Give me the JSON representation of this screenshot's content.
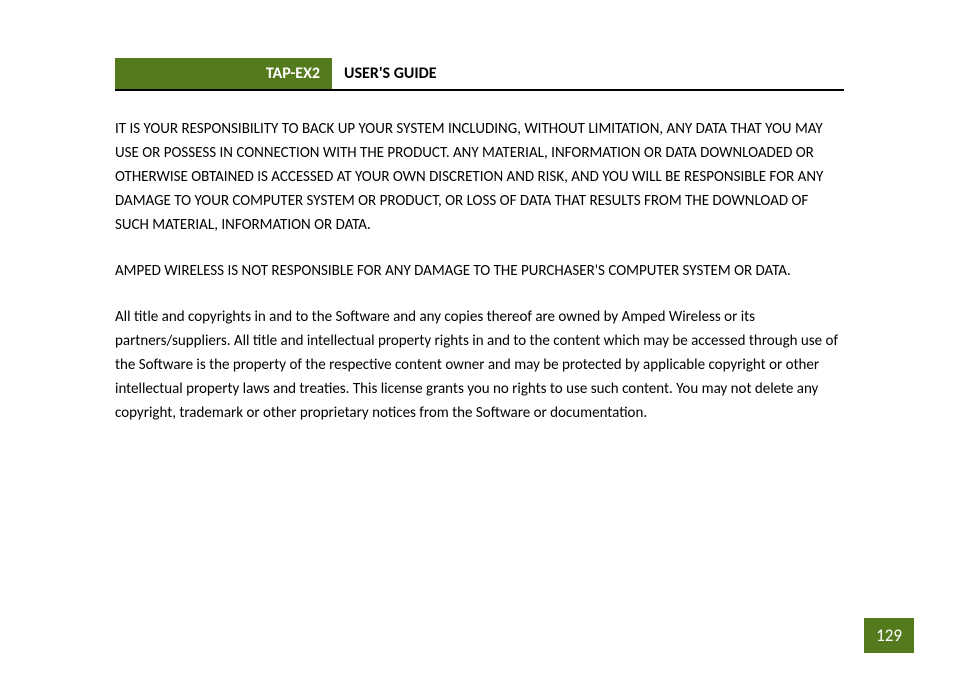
{
  "header": {
    "product": "TAP-EX2",
    "title": "USER'S GUIDE"
  },
  "paragraphs": [
    "IT IS YOUR RESPONSIBILITY TO BACK UP YOUR SYSTEM INCLUDING, WITHOUT LIMITATION, ANY DATA THAT YOU MAY USE OR POSSESS IN CONNECTION WITH THE PRODUCT.  ANY MATERIAL, INFORMATION OR DATA DOWNLOADED OR OTHERWISE OBTAINED IS ACCESSED AT YOUR OWN DISCRETION AND RISK, AND YOU WILL BE RESPONSIBLE FOR ANY DAMAGE TO YOUR COMPUTER SYSTEM OR PRODUCT, OR LOSS OF DATA THAT RESULTS FROM THE DOWNLOAD OF SUCH MATERIAL, INFORMATION OR DATA.",
    "AMPED WIRELESS IS NOT RESPONSIBLE FOR ANY DAMAGE TO THE PURCHASER'S COMPUTER SYSTEM OR DATA.",
    "All title and copyrights in and to the Software and any copies thereof are owned by Amped Wireless or its partners/suppliers.  All title and intellectual property rights in and to the content which may be accessed through use of the Software is the property of the respective content owner and may be protected by applicable copyright or other intellectual property laws and treaties.  This license grants you no rights to use such content.  You may not delete any copyright, trademark or other proprietary notices from the Software or documentation."
  ],
  "page_number": "129"
}
